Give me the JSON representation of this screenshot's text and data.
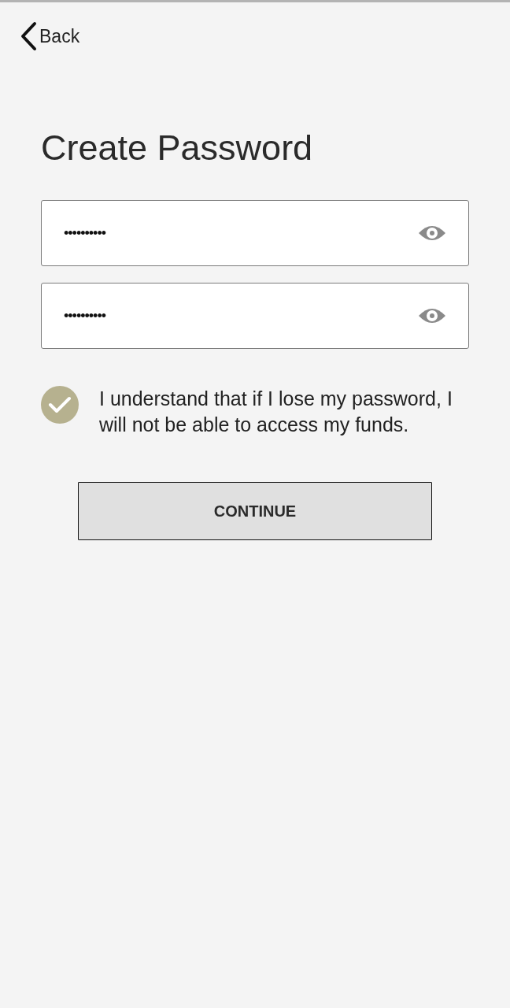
{
  "nav": {
    "back_label": "Back"
  },
  "title": "Create Password",
  "password_fields": [
    {
      "value": "••••••••••"
    },
    {
      "value": "••••••••••"
    }
  ],
  "agreement": {
    "checked": true,
    "text": "I understand that if I lose my password, I will not be able to access my funds."
  },
  "continue_button": {
    "label": "CONTINUE"
  }
}
